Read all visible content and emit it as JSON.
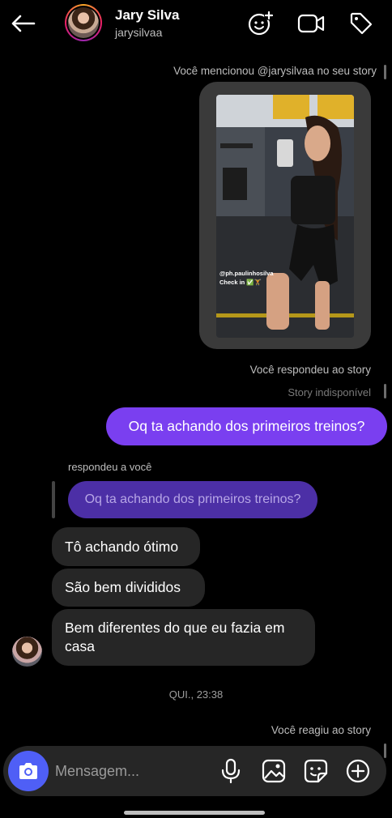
{
  "header": {
    "name": "Jary Silva",
    "username": "jarysilvaa"
  },
  "thread": {
    "mention_notice": "Você mencionou @jarysilvaa no seu story",
    "story_tag_line1": "@ph.paulinhosilva",
    "story_tag_line2": "Check in ✅🏋",
    "replied_story_notice": "Você respondeu ao story",
    "story_unavailable": "Story indisponível",
    "outgoing_message": "Oq ta achando dos primeiros treinos?",
    "reply_label": "respondeu a você",
    "quoted_message": "Oq ta achando dos primeiros treinos?",
    "incoming_messages": [
      "Tô achando ótimo",
      "São bem divididos",
      "Bem diferentes do que eu fazia em casa"
    ],
    "timestamp": "QUI., 23:38",
    "reacted_story_notice": "Você reagiu ao story"
  },
  "composer": {
    "placeholder": "Mensagem..."
  },
  "colors": {
    "outgoing_bubble": "#7a3ff0",
    "quoted_bubble": "#4c2fa6",
    "incoming_bubble": "#262626",
    "camera_button": "#4f5ff6"
  },
  "icons": [
    "back-arrow-icon",
    "add-people-icon",
    "video-call-icon",
    "tag-icon",
    "camera-icon",
    "microphone-icon",
    "gallery-icon",
    "sticker-icon",
    "plus-circle-icon"
  ]
}
